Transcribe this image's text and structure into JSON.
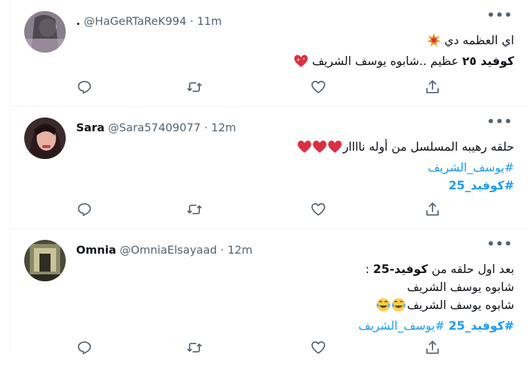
{
  "tweets": [
    {
      "name": ".",
      "handle": "@HaGeRTaReK994",
      "sep": "·",
      "time": "11m",
      "lines": [
        {
          "text": "اي العظمه دي",
          "emoji": "collision-emoji"
        },
        {
          "text_bold": "كوفيد ٢٥",
          "text": " عظيم ..شابوه يوسف الشريف",
          "emoji": "sparkling-heart-emoji"
        }
      ]
    },
    {
      "name": "Sara",
      "handle": "@Sara57409077",
      "sep": "·",
      "time": "12m",
      "lines": [
        {
          "text": "حلقه رهيبه المسلسل من أوله ناااار",
          "emoji": "red-heart-emoji-x3"
        },
        {
          "hashtag": "#يوسف_الشريف"
        },
        {
          "hashtag": "#كوفيد_25"
        }
      ]
    },
    {
      "name": "Omnia",
      "handle": "@OmniaElsayaad",
      "sep": "·",
      "time": "12m",
      "lines": [
        {
          "text": "بعد اول حلقه من ",
          "text_bold": "كوفيد-25",
          "text2": " :"
        },
        {
          "text": "شابوه يوسف الشريف"
        },
        {
          "text": "شابوه يوسف الشريف",
          "emoji": "tears-of-joy-emoji-x2"
        },
        {
          "hashtag": "#كوفيد_25",
          "hashtag2": "#يوسف_الشريف"
        }
      ]
    }
  ],
  "more_label": "•••",
  "colors": {
    "accent": "#1d9bf0",
    "secondary": "#536471",
    "border": "#eff3f4"
  },
  "icons": [
    "reply-icon",
    "retweet-icon",
    "like-icon",
    "share-icon"
  ]
}
